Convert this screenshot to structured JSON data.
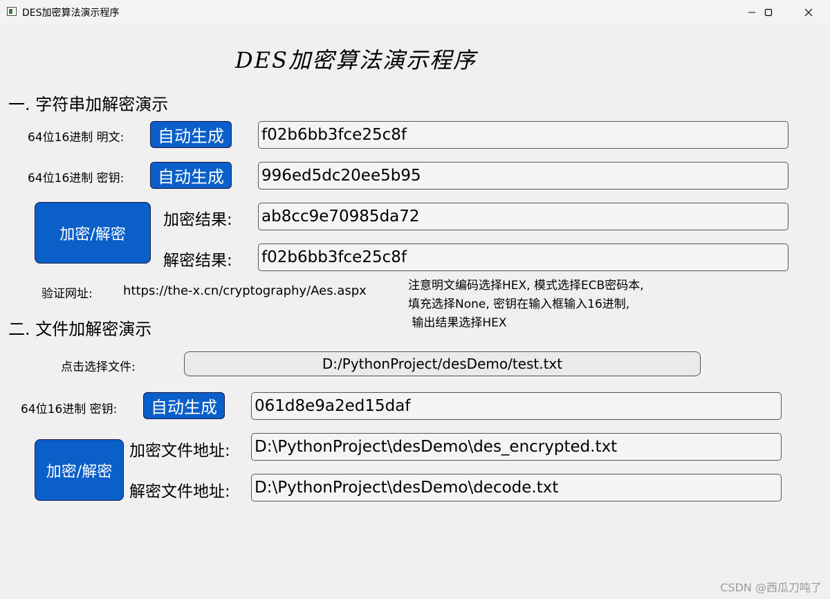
{
  "window": {
    "title": "DES加密算法演示程序"
  },
  "heading": "DES加密算法演示程序",
  "section1": {
    "title": "一. 字符串加解密演示",
    "plaintext_label": "64位16进制 明文:",
    "plaintext_auto_label": "自动生成",
    "plaintext_value": "f02b6bb3fce25c8f",
    "key_label": "64位16进制 密钥:",
    "key_auto_label": "自动生成",
    "key_value": "996ed5dc20ee5b95",
    "encrypt_decrypt_label": "加密/解密",
    "encrypt_result_label": "加密结果:",
    "encrypt_result_value": "ab8cc9e70985da72",
    "decrypt_result_label": "解密结果:",
    "decrypt_result_value": "f02b6bb3fce25c8f",
    "verify_label": "验证网址:",
    "verify_url": "https://the-x.cn/cryptography/Aes.aspx",
    "note_lines": [
      "注意明文编码选择HEX, 模式选择ECB密码本,",
      "填充选择None, 密钥在输入框输入16进制,",
      " 输出结果选择HEX"
    ]
  },
  "section2": {
    "title": "二. 文件加解密演示",
    "choose_file_label": "点击选择文件:",
    "file_path": "D:/PythonProject/desDemo/test.txt",
    "key_label": "64位16进制 密钥:",
    "key_auto_label": "自动生成",
    "key_value": "061d8e9a2ed15daf",
    "encrypt_decrypt_label": "加密/解密",
    "encrypted_path_label": "加密文件地址:",
    "encrypted_path_value": "D:\\PythonProject\\desDemo\\des_encrypted.txt",
    "decrypted_path_label": "解密文件地址:",
    "decrypted_path_value": "D:\\PythonProject\\desDemo\\decode.txt"
  },
  "watermark": "CSDN @西瓜刀吨了",
  "colors": {
    "button_blue": "#0a5fc9",
    "window_background": "#f0f0f0"
  },
  "icons": [
    "app-window-icon",
    "minimize-icon",
    "maximize-icon",
    "close-icon"
  ]
}
